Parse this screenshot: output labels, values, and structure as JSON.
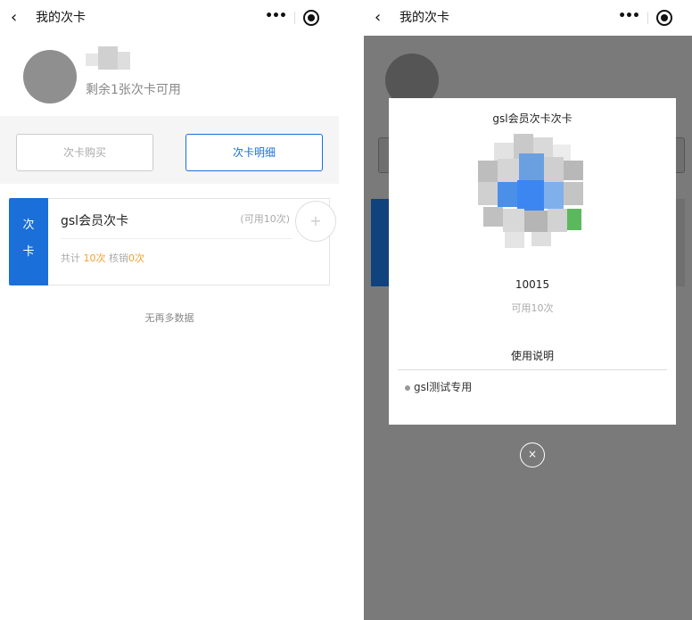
{
  "left": {
    "nav": {
      "back_icon": "‹",
      "title": "我的次卡",
      "more": "•••"
    },
    "profile": {
      "remain_text": "剩余1张次卡可用"
    },
    "tabs": {
      "buy": "次卡购买",
      "detail": "次卡明细"
    },
    "card": {
      "stub_label": [
        "次",
        "卡"
      ],
      "name": "gsl会员次卡",
      "avail": "(可用10次)",
      "stats_prefix": "共计 ",
      "total": "10次",
      "stats_mid": " 核销",
      "used": "0次",
      "add_icon": "+"
    },
    "no_more": "无再多数据"
  },
  "right": {
    "nav": {
      "back_icon": "‹",
      "title": "我的次卡",
      "more": "•••"
    },
    "modal": {
      "title": "gsl会员次卡次卡",
      "card_no": "10015",
      "avail": "可用10次",
      "usage_title": "使用说明",
      "usage_items": [
        "gsl测试专用"
      ],
      "close_icon": "×"
    }
  },
  "colors": {
    "accent": "#1a6fd9",
    "highlight": "#f0a030",
    "overlay": "#7a7a7a"
  },
  "icons": {
    "back": "chevron-left-icon",
    "more": "more-dots-icon",
    "close": "close-circle-icon",
    "add": "plus-icon"
  }
}
